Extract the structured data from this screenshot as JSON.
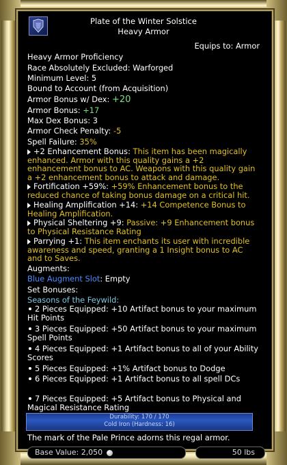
{
  "item": {
    "name": "Plate of the Winter Solstice",
    "subtype": "Heavy Armor",
    "equips_to": "Equips to: Armor"
  },
  "props": {
    "proficiency": "Heavy Armor Proficiency",
    "race": "Race Absolutely Excluded: Warforged",
    "min_level": "Minimum Level: 5",
    "bound": "Bound to Account (from Acquisition)",
    "armor_dex_label": "Armor Bonus w/ Dex: ",
    "armor_dex_value": "+20",
    "armor_bonus_label": "Armor Bonus: ",
    "armor_bonus_value": "+17",
    "max_dex": "Max Dex Bonus: 3",
    "check_label": "Armor Check Penalty: ",
    "check_value": "-5",
    "spell_label": "Spell Failure: ",
    "spell_value": "35%"
  },
  "effects": [
    {
      "name": "+2 Enhancement Bonus:",
      "desc": " This item has been magically enhanced. Armor with this quality gains a +2 enhancement bonus to AC. Weapons with this quality gain a +2 enhancement bonus to attack and damage."
    },
    {
      "name": "Fortification +59%:",
      "desc": " +59% Enhancement bonus to the reduced chance of taking bonus damage on a critical hit."
    },
    {
      "name": "Healing Amplification +14:",
      "desc": " +14 Competence Bonus to Healing Amplification."
    },
    {
      "name": "Physical Sheltering +9:",
      "desc": " Passive: +9 Enhancement bonus to Physical Resistance Rating"
    },
    {
      "name": "Parrying +1:",
      "desc": " This item enchants its user with incredible awareness and speed, granting a 1 Insight bonus to AC and to Saves."
    }
  ],
  "augments": {
    "label": "Augments:",
    "slot": "Blue Augment Slot",
    "slot_value": ": Empty"
  },
  "set": {
    "label": "Set Bonuses:",
    "name": "Seasons of the Feywild:",
    "bonuses": [
      "2 Pieces Equipped: +10 Artifact bonus to your maximum Hit Points",
      "3 Pieces Equipped: +50 Artifact bonus to your maximum Spell Points",
      "4 Pieces Equipped: +1 Artifact bonus to all of your Ability Scores",
      "5 Pieces Equipped: +1% Artifact bonus to Dodge",
      "6 Pieces Equipped: +1 Artifact bonus to all spell DCs",
      "7 Pieces Equipped: +5 Artifact bonus to Physical and Magical Resistance Rating"
    ]
  },
  "durability": {
    "line1": "Durability: 170 / 170",
    "line2": "Cold Iron (Hardness: 16)"
  },
  "flavor": "The mark of the Pale Prince adorns this regal armor.",
  "footer": {
    "base_value": "Base Value: 2,050",
    "weight": "50 lbs"
  },
  "colors": {
    "gold_text": "#e0c020",
    "green_text": "#7ee07e",
    "set_name": "#7ec8e0",
    "augment_slot": "#4a8cff",
    "frame_gold": "#c8b070"
  },
  "icons": [
    "armor-item-icon",
    "coin-icon"
  ]
}
